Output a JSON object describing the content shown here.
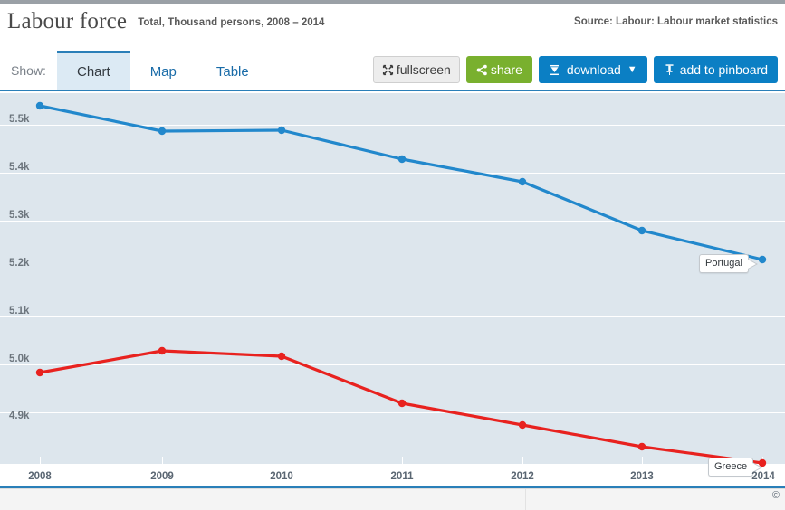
{
  "header": {
    "title": "Labour force",
    "subtitle": "Total, Thousand persons, 2008 – 2014",
    "source": "Source: Labour: Labour market statistics"
  },
  "toolbar": {
    "show_label": "Show:",
    "tabs": [
      {
        "label": "Chart",
        "active": true
      },
      {
        "label": "Map",
        "active": false
      },
      {
        "label": "Table",
        "active": false
      }
    ],
    "buttons": {
      "fullscreen": "fullscreen",
      "share": "share",
      "download": "download",
      "download_caret": "▼",
      "pinboard": "add to pinboard"
    },
    "icons": {
      "fullscreen": "fullscreen-icon",
      "share": "share-icon",
      "download": "download-icon",
      "pinboard": "pin-icon"
    }
  },
  "colors": {
    "accent_blue": "#0b7fc4",
    "tab_blue": "#2a7fb8",
    "share_green": "#79b02e",
    "portugal_line": "#2288cc",
    "greece_line": "#e8221f",
    "plot_bg": "#e0e8ef",
    "plot_band": "#dde6ed",
    "gridline": "#ffffff"
  },
  "chart_data": {
    "type": "line",
    "title": "Labour force",
    "subtitle": "Total, Thousand persons, 2008 – 2014",
    "xlabel": "",
    "ylabel": "",
    "x": [
      2008,
      2009,
      2010,
      2011,
      2012,
      2013,
      2014
    ],
    "xtick_labels": [
      "2008",
      "2009",
      "2010",
      "2011",
      "2012",
      "2013",
      "2014"
    ],
    "ytick_labels": [
      "5.5k",
      "5.4k",
      "5.3k",
      "5.2k",
      "5.1k",
      "5.0k",
      "4.9k"
    ],
    "ytick_values": [
      5500,
      5400,
      5300,
      5200,
      5100,
      5000,
      4900
    ],
    "ylim": [
      4850,
      5560
    ],
    "grid": true,
    "legend": "inline-end-labels",
    "units": "Thousand persons",
    "series": [
      {
        "name": "Portugal",
        "color": "#2288cc",
        "values": [
          5540,
          5487,
          5489,
          5443,
          5425,
          5322,
          5263
        ]
      },
      {
        "name": "Greece",
        "color": "#e8221f",
        "values": [
          4996,
          5021,
          5016,
          4932,
          4885,
          4840,
          4806
        ]
      }
    ]
  },
  "footer": {
    "copyright": "©"
  }
}
